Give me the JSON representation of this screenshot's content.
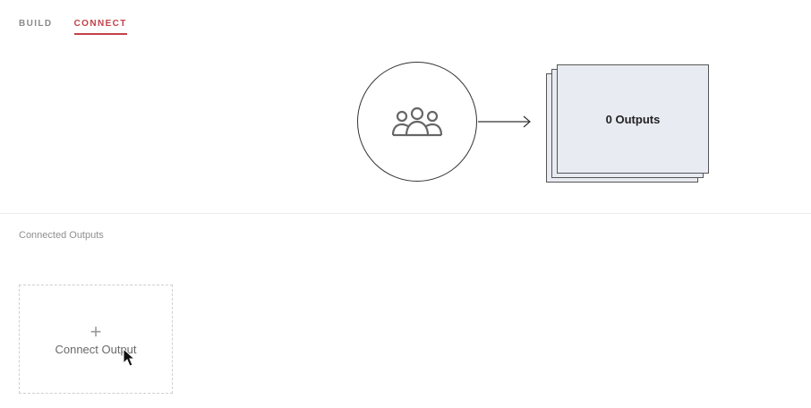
{
  "tabs": [
    {
      "label": "BUILD",
      "active": false
    },
    {
      "label": "CONNECT",
      "active": true
    }
  ],
  "diagram": {
    "audience_icon": "people-group-icon",
    "arrow_icon": "arrow-right-icon",
    "outputs_label": "0 Outputs"
  },
  "connected_outputs": {
    "title": "Connected Outputs",
    "add_tile": {
      "icon": "plus-icon",
      "plus_glyph": "+",
      "label": "Connect Output"
    }
  },
  "colors": {
    "accent": "#c2414b",
    "card_fill": "#e8ebf1",
    "muted_text": "#8f8f8f"
  }
}
